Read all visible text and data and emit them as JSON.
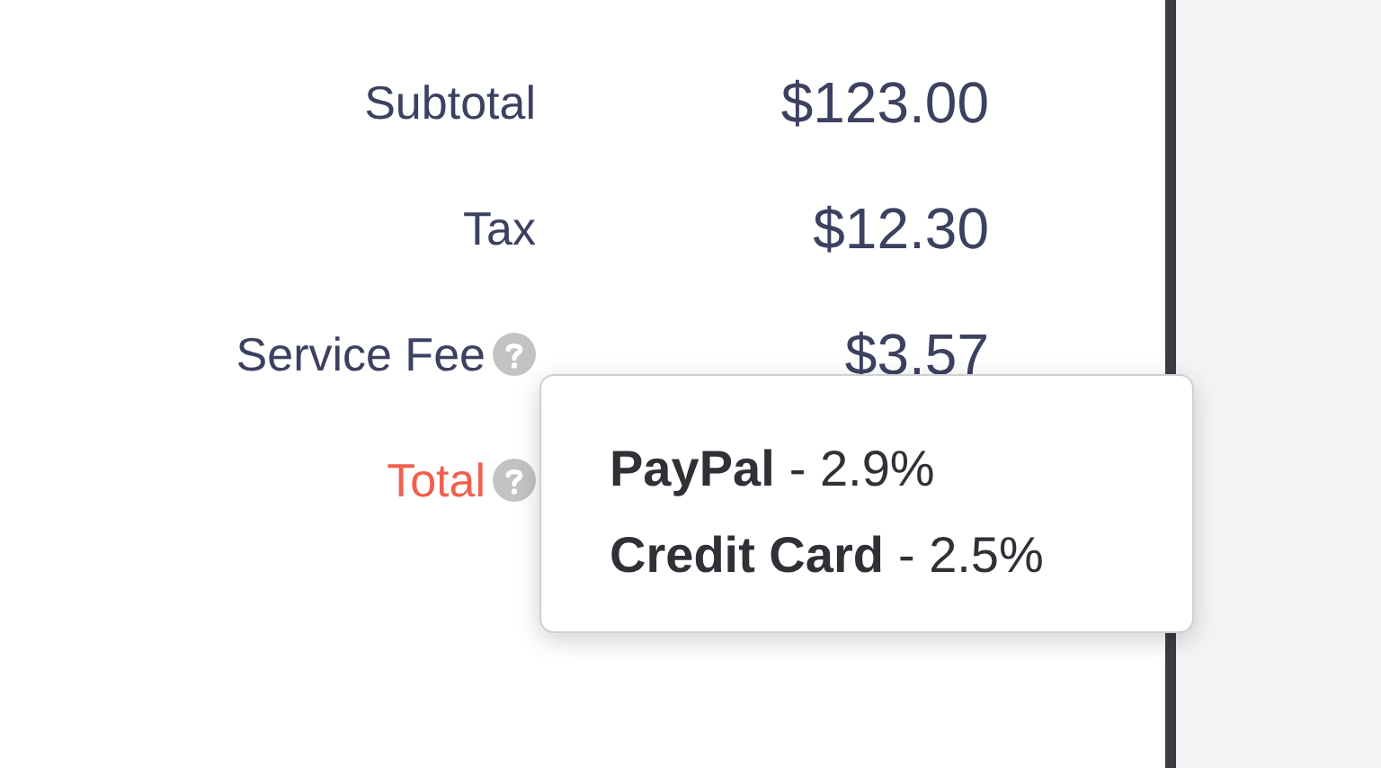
{
  "summary": [
    {
      "label": "Subtotal",
      "value": "$123.00",
      "help": false,
      "kind": "normal"
    },
    {
      "label": "Tax",
      "value": "$12.30",
      "help": false,
      "kind": "normal"
    },
    {
      "label": "Service Fee",
      "value": "$3.57",
      "help": true,
      "kind": "normal"
    },
    {
      "label": "Total",
      "help": true,
      "kind": "total"
    }
  ],
  "tooltip": {
    "lines": [
      {
        "method": "PayPal",
        "rate": "- 2.9%"
      },
      {
        "method": "Credit Card",
        "rate": "- 2.5%"
      }
    ]
  }
}
